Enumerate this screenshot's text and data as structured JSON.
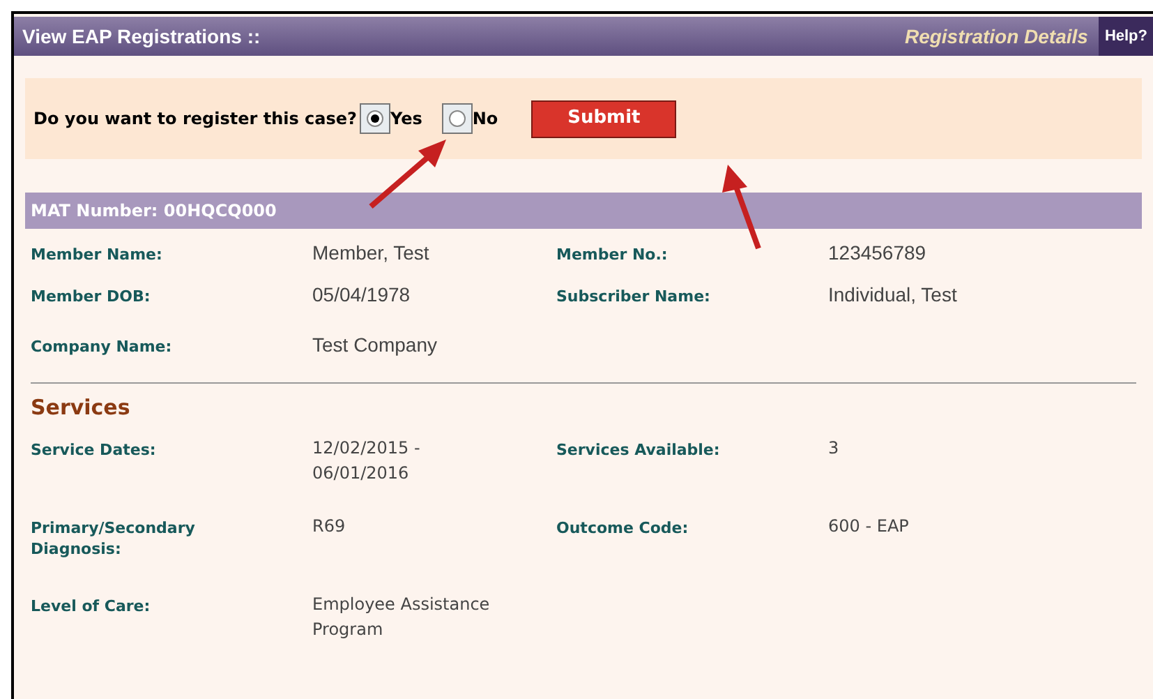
{
  "header": {
    "title": "View EAP Registrations ::",
    "subtitle": "Registration Details",
    "help": "Help?"
  },
  "register": {
    "question": "Do you want to register this case?",
    "options": [
      {
        "label": "Yes",
        "selected": true
      },
      {
        "label": "No",
        "selected": false
      }
    ],
    "submit": "Submit"
  },
  "mat_header": "MAT Number: 00HQCQ000",
  "member_rows": [
    [
      {
        "label": "Member Name:",
        "value": "Member, Test"
      },
      {
        "label": "Member No.:",
        "value": "123456789"
      }
    ],
    [
      {
        "label": "Member DOB:",
        "value": "05/04/1978"
      },
      {
        "label": "Subscriber Name:",
        "value": "Individual, Test"
      }
    ],
    [
      {
        "label": "Company Name:",
        "value": "Test Company"
      }
    ]
  ],
  "services": {
    "title": "Services",
    "rows": [
      [
        {
          "label": "Service Dates:",
          "value": "12/02/2015 - 06/01/2016"
        },
        {
          "label": "Services Available:",
          "value": "3"
        }
      ],
      [
        {
          "label": "Primary/Secondary Diagnosis:",
          "value": "R69"
        },
        {
          "label": "Outcome Code:",
          "value": "600 - EAP"
        }
      ],
      [
        {
          "label": "Level of Care:",
          "value": "Employee Assistance Program"
        }
      ]
    ]
  }
}
